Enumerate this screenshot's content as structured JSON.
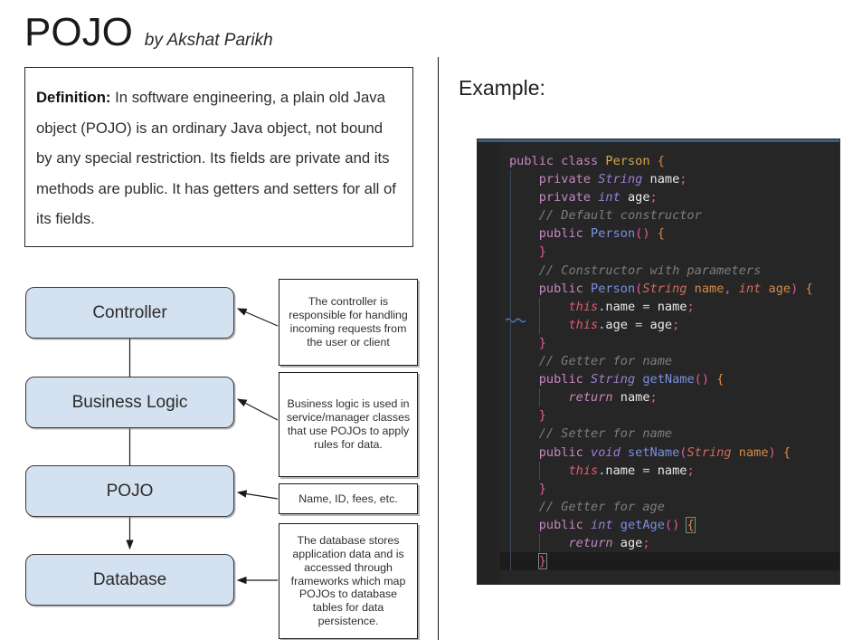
{
  "header": {
    "title": "POJO",
    "byline": "by Akshat Parikh"
  },
  "definition": {
    "label": "Definition:",
    "text": " In software engineering, a plain old Java object (POJO) is an ordinary Java object, not bound by any special restriction.  Its fields are private and its methods are public. It has getters and setters for all of its fields."
  },
  "flow": {
    "boxes": [
      {
        "label": "Controller"
      },
      {
        "label": "Business Logic"
      },
      {
        "label": "POJO"
      },
      {
        "label": "Database"
      }
    ],
    "notes": [
      {
        "text": "The controller is responsible for handling incoming requests from the user or client"
      },
      {
        "text": "Business logic is used in service/manager classes that use POJOs to apply rules for data."
      },
      {
        "text": "Name, ID, fees, etc."
      },
      {
        "text": "The database stores application data and is accessed through frameworks which map POJOs to database tables for data persistence."
      }
    ]
  },
  "example": {
    "heading": "Example:",
    "language": "java",
    "code_plain": "public class Person {\n    private String name;\n    private int age;\n    // Default constructor\n    public Person() {\n    }\n    // Constructor with parameters\n    public Person(String name, int age) {\n        this.name = name;\n        this.age = age;\n    }\n    // Getter for name\n    public String getName() {\n        return name;\n    }\n    // Setter for name\n    public void setName(String name) {\n        this.name = name;\n    }\n    // Getter for age\n    public int getAge() {\n        return age;\n    }",
    "lines": [
      {
        "indent": 0,
        "tokens": [
          {
            "t": "public",
            "c": "kw"
          },
          {
            "t": " ",
            "c": "op"
          },
          {
            "t": "class",
            "c": "kw"
          },
          {
            "t": " ",
            "c": "op"
          },
          {
            "t": "Person",
            "c": "cls"
          },
          {
            "t": " ",
            "c": "op"
          },
          {
            "t": "{",
            "c": "par"
          }
        ]
      },
      {
        "indent": 1,
        "tokens": [
          {
            "t": "private",
            "c": "kw"
          },
          {
            "t": " ",
            "c": "op"
          },
          {
            "t": "String",
            "c": "typ"
          },
          {
            "t": " ",
            "c": "op"
          },
          {
            "t": "name",
            "c": "id"
          },
          {
            "t": ";",
            "c": "punc"
          }
        ]
      },
      {
        "indent": 1,
        "tokens": [
          {
            "t": "private",
            "c": "kw"
          },
          {
            "t": " ",
            "c": "op"
          },
          {
            "t": "int",
            "c": "typ"
          },
          {
            "t": " ",
            "c": "op"
          },
          {
            "t": "age",
            "c": "id"
          },
          {
            "t": ";",
            "c": "punc"
          }
        ]
      },
      {
        "indent": 1,
        "tokens": [
          {
            "t": "// Default constructor",
            "c": "cmt"
          }
        ]
      },
      {
        "indent": 1,
        "tokens": [
          {
            "t": "public",
            "c": "kw"
          },
          {
            "t": " ",
            "c": "op"
          },
          {
            "t": "Person",
            "c": "fn"
          },
          {
            "t": "()",
            "c": "punc"
          },
          {
            "t": " ",
            "c": "op"
          },
          {
            "t": "{",
            "c": "par"
          }
        ]
      },
      {
        "indent": 1,
        "tokens": [
          {
            "t": "}",
            "c": "punc"
          }
        ]
      },
      {
        "indent": 1,
        "tokens": [
          {
            "t": "// Constructor with parameters",
            "c": "cmt"
          }
        ]
      },
      {
        "indent": 1,
        "tokens": [
          {
            "t": "public",
            "c": "kw"
          },
          {
            "t": " ",
            "c": "op"
          },
          {
            "t": "Person",
            "c": "fn"
          },
          {
            "t": "(",
            "c": "punc"
          },
          {
            "t": "String",
            "c": "typo"
          },
          {
            "t": " ",
            "c": "op"
          },
          {
            "t": "name",
            "c": "par"
          },
          {
            "t": ",",
            "c": "punc"
          },
          {
            "t": " ",
            "c": "op"
          },
          {
            "t": "int",
            "c": "typo"
          },
          {
            "t": " ",
            "c": "op"
          },
          {
            "t": "age",
            "c": "par"
          },
          {
            "t": ")",
            "c": "punc"
          },
          {
            "t": " ",
            "c": "op"
          },
          {
            "t": "{",
            "c": "par"
          }
        ]
      },
      {
        "indent": 2,
        "tokens": [
          {
            "t": "this",
            "c": "ths"
          },
          {
            "t": ".",
            "c": "op"
          },
          {
            "t": "name",
            "c": "id"
          },
          {
            "t": " = ",
            "c": "op"
          },
          {
            "t": "name",
            "c": "id"
          },
          {
            "t": ";",
            "c": "punc"
          }
        ]
      },
      {
        "indent": 2,
        "tokens": [
          {
            "t": "this",
            "c": "ths"
          },
          {
            "t": ".",
            "c": "op"
          },
          {
            "t": "age",
            "c": "id"
          },
          {
            "t": " = ",
            "c": "op"
          },
          {
            "t": "age",
            "c": "id"
          },
          {
            "t": ";",
            "c": "punc"
          }
        ]
      },
      {
        "indent": 1,
        "tokens": [
          {
            "t": "}",
            "c": "punc"
          }
        ]
      },
      {
        "indent": 1,
        "tokens": [
          {
            "t": "// Getter for name",
            "c": "cmt"
          }
        ]
      },
      {
        "indent": 1,
        "tokens": [
          {
            "t": "public",
            "c": "kw"
          },
          {
            "t": " ",
            "c": "op"
          },
          {
            "t": "String",
            "c": "typ"
          },
          {
            "t": " ",
            "c": "op"
          },
          {
            "t": "getName",
            "c": "fn"
          },
          {
            "t": "()",
            "c": "punc"
          },
          {
            "t": " ",
            "c": "op"
          },
          {
            "t": "{",
            "c": "par"
          }
        ]
      },
      {
        "indent": 2,
        "tokens": [
          {
            "t": "return",
            "c": "kwi"
          },
          {
            "t": " ",
            "c": "op"
          },
          {
            "t": "name",
            "c": "id"
          },
          {
            "t": ";",
            "c": "punc"
          }
        ]
      },
      {
        "indent": 1,
        "tokens": [
          {
            "t": "}",
            "c": "punc"
          }
        ]
      },
      {
        "indent": 1,
        "tokens": [
          {
            "t": "// Setter for name",
            "c": "cmt"
          }
        ]
      },
      {
        "indent": 1,
        "tokens": [
          {
            "t": "public",
            "c": "kw"
          },
          {
            "t": " ",
            "c": "op"
          },
          {
            "t": "void",
            "c": "typ"
          },
          {
            "t": " ",
            "c": "op"
          },
          {
            "t": "setName",
            "c": "fn"
          },
          {
            "t": "(",
            "c": "punc"
          },
          {
            "t": "String",
            "c": "typo"
          },
          {
            "t": " ",
            "c": "op"
          },
          {
            "t": "name",
            "c": "par"
          },
          {
            "t": ")",
            "c": "punc"
          },
          {
            "t": " ",
            "c": "op"
          },
          {
            "t": "{",
            "c": "par"
          }
        ]
      },
      {
        "indent": 2,
        "tokens": [
          {
            "t": "this",
            "c": "ths"
          },
          {
            "t": ".",
            "c": "op"
          },
          {
            "t": "name",
            "c": "id"
          },
          {
            "t": " = ",
            "c": "op"
          },
          {
            "t": "name",
            "c": "id"
          },
          {
            "t": ";",
            "c": "punc"
          }
        ]
      },
      {
        "indent": 1,
        "tokens": [
          {
            "t": "}",
            "c": "punc"
          }
        ]
      },
      {
        "indent": 1,
        "tokens": [
          {
            "t": "// Getter for age",
            "c": "cmt"
          }
        ]
      },
      {
        "indent": 1,
        "tokens": [
          {
            "t": "public",
            "c": "kw"
          },
          {
            "t": " ",
            "c": "op"
          },
          {
            "t": "int",
            "c": "typ"
          },
          {
            "t": " ",
            "c": "op"
          },
          {
            "t": "getAge",
            "c": "fn"
          },
          {
            "t": "()",
            "c": "punc"
          },
          {
            "t": " ",
            "c": "op"
          },
          {
            "t": "{",
            "c": "par",
            "hl": true
          }
        ]
      },
      {
        "indent": 2,
        "tokens": [
          {
            "t": "return",
            "c": "kwi"
          },
          {
            "t": " ",
            "c": "op"
          },
          {
            "t": "age",
            "c": "id"
          },
          {
            "t": ";",
            "c": "punc"
          }
        ]
      },
      {
        "indent": 1,
        "current": true,
        "tokens": [
          {
            "t": "}",
            "c": "punc",
            "hl": true
          }
        ]
      }
    ]
  },
  "colors": {
    "flow_box_fill": "#d4e1f0",
    "flow_box_border": "#3b3b3b",
    "code_background": "#262626",
    "code_accent": "#3b5a84",
    "keyword": "#c586c0",
    "class_name": "#d7a84b",
    "function_name": "#7a8fe0",
    "comment": "#7d7d7d",
    "this_keyword": "#e05a6e",
    "parameter": "#d98a4a",
    "punctuation": "#e05a9e"
  }
}
